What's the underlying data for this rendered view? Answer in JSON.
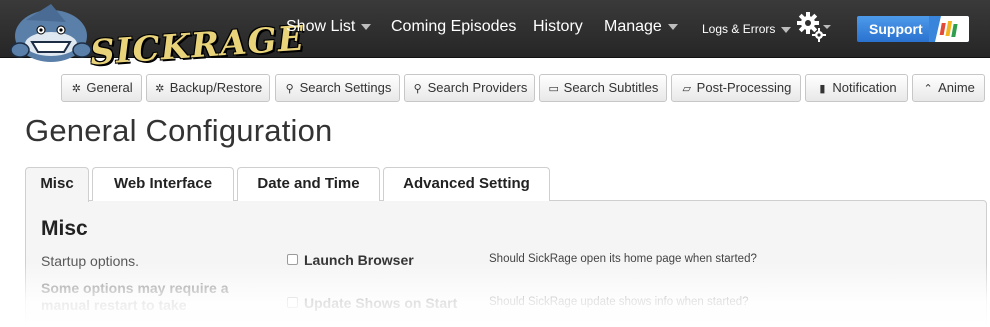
{
  "app": {
    "logo_text": "SICKRAGE"
  },
  "nav": {
    "items": [
      {
        "label": "Show List",
        "dropdown": true
      },
      {
        "label": "Coming Episodes",
        "dropdown": false
      },
      {
        "label": "History",
        "dropdown": false
      },
      {
        "label": "Manage",
        "dropdown": true
      },
      {
        "label": "Logs & Errors",
        "dropdown": true
      }
    ],
    "settings_icon": "gear-icon",
    "support_label": "Support"
  },
  "subnav": {
    "buttons": [
      {
        "label": "General",
        "icon": "gear-icon"
      },
      {
        "label": "Backup/Restore",
        "icon": "gear-icon"
      },
      {
        "label": "Search Settings",
        "icon": "search-icon"
      },
      {
        "label": "Search Providers",
        "icon": "search-icon"
      },
      {
        "label": "Search Subtitles",
        "icon": "comment-icon"
      },
      {
        "label": "Post-Processing",
        "icon": "folder-open-icon"
      },
      {
        "label": "Notification",
        "icon": "book-icon"
      },
      {
        "label": "Anime",
        "icon": "chevron-up-icon"
      }
    ]
  },
  "page": {
    "title": "General Configuration"
  },
  "tabs": [
    {
      "label": "Misc",
      "active": true
    },
    {
      "label": "Web Interface",
      "active": false
    },
    {
      "label": "Date and Time",
      "active": false
    },
    {
      "label": "Advanced Setting",
      "active": false
    }
  ],
  "section": {
    "title": "Misc",
    "description": "Startup options.",
    "note": "Some options may require a manual restart to take"
  },
  "options": [
    {
      "label": "Launch Browser",
      "description": "Should SickRage open its home page when started?",
      "checked": false
    },
    {
      "label": "Update Shows on Start",
      "description": "Should SickRage update shows info when started?",
      "checked": false
    }
  ],
  "colors": {
    "navbar": "#2e2e2e",
    "support_button": "#3a85dc",
    "panel": "#f5f5f5"
  }
}
